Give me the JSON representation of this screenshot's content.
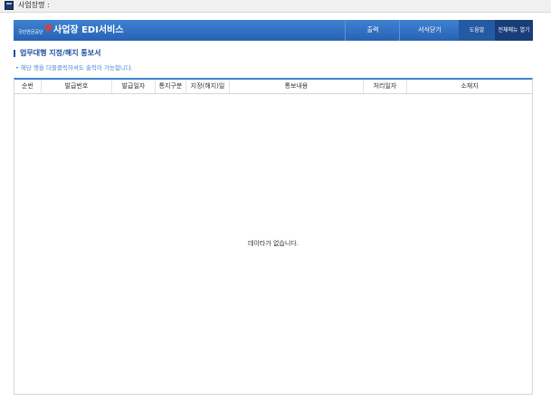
{
  "top_bar": {
    "label": "사업장명 :",
    "icon": "window-icon"
  },
  "header": {
    "logo_text": "국민연금공단",
    "title": "사업장 EDI서비스",
    "buttons": {
      "print": "출력",
      "close": "서식닫기",
      "help": "도움말",
      "all_menu": "전체메뉴 열기"
    }
  },
  "section": {
    "title": "업무대행 지정/해지 통보서",
    "hint": "• 해당 행을 더블클릭하셔도 출력이 가능합니다."
  },
  "table": {
    "columns": [
      "순번",
      "발급번호",
      "발급일자",
      "통지구분",
      "지정(해지)일",
      "통보내용",
      "처리일자",
      "소재지"
    ],
    "empty_message": "데이타가 없습니다."
  },
  "colors": {
    "header_blue": "#2f6fbf",
    "accent": "#1f4fa0",
    "hint": "#4a88d4"
  }
}
